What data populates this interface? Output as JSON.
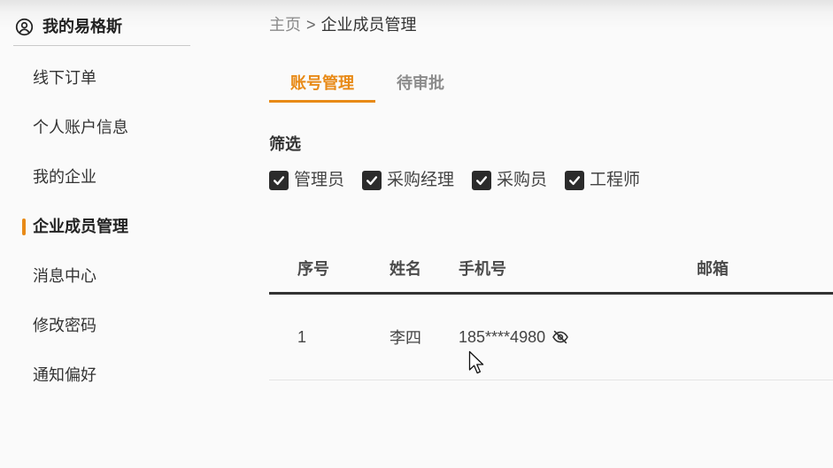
{
  "sidebar": {
    "title": "我的易格斯",
    "title_icon": "user-circle-icon",
    "items": [
      {
        "label": "线下订单",
        "active": false
      },
      {
        "label": "个人账户信息",
        "active": false
      },
      {
        "label": "我的企业",
        "active": false
      },
      {
        "label": "企业成员管理",
        "active": true
      },
      {
        "label": "消息中心",
        "active": false
      },
      {
        "label": "修改密码",
        "active": false
      },
      {
        "label": "通知偏好",
        "active": false
      }
    ]
  },
  "breadcrumb": {
    "home": "主页",
    "separator": ">",
    "current": "企业成员管理"
  },
  "tabs": [
    {
      "label": "账号管理",
      "active": true
    },
    {
      "label": "待审批",
      "active": false
    }
  ],
  "filter": {
    "title": "筛选",
    "options": [
      {
        "label": "管理员",
        "checked": true
      },
      {
        "label": "采购经理",
        "checked": true
      },
      {
        "label": "采购员",
        "checked": true
      },
      {
        "label": "工程师",
        "checked": true
      }
    ]
  },
  "table": {
    "columns": [
      "序号",
      "姓名",
      "手机号",
      "邮箱"
    ],
    "rows": [
      {
        "index": "1",
        "name": "李四",
        "phone": "185****4980",
        "phone_visibility_icon": "eye-slash-icon",
        "email": ""
      }
    ]
  },
  "colors": {
    "accent": "#e88a17",
    "checkbox": "#2b2b2b",
    "text": "#333333"
  }
}
